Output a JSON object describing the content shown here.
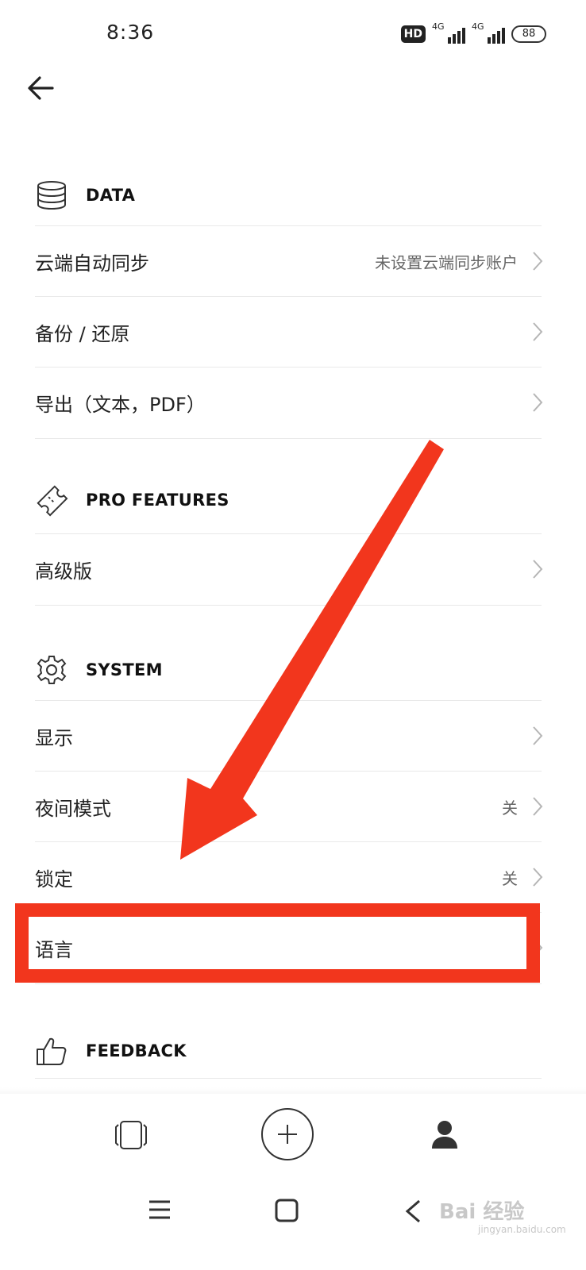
{
  "status_bar": {
    "time": "8:36",
    "hd_badge": "HD",
    "network_1": "4G",
    "network_2": "4G",
    "battery": "88"
  },
  "sections": {
    "data": {
      "title": "DATA",
      "icon": "database-icon",
      "rows": [
        {
          "label": "云端自动同步",
          "value": "未设置云端同步账户"
        },
        {
          "label": "备份 / 还原",
          "value": ""
        },
        {
          "label": "导出（文本，PDF）",
          "value": ""
        }
      ]
    },
    "pro": {
      "title": "PRO FEATURES",
      "icon": "ticket-icon",
      "rows": [
        {
          "label": "高级版",
          "value": ""
        }
      ]
    },
    "system": {
      "title": "SYSTEM",
      "icon": "gear-icon",
      "rows": [
        {
          "label": "显示",
          "value": ""
        },
        {
          "label": "夜间模式",
          "value": "关"
        },
        {
          "label": "锁定",
          "value": "关"
        },
        {
          "label": "语言",
          "value": ""
        }
      ]
    },
    "feedback": {
      "title": "FEEDBACK",
      "icon": "thumbs-up-icon"
    }
  },
  "bottom_nav": [
    "cards-icon",
    "add-icon",
    "profile-icon"
  ],
  "system_nav": [
    "menu-icon",
    "home-icon",
    "back-icon"
  ],
  "annotation_color": "#f2361d",
  "watermark": {
    "main": "Bai 经验",
    "sub": "jingyan.baidu.com"
  }
}
